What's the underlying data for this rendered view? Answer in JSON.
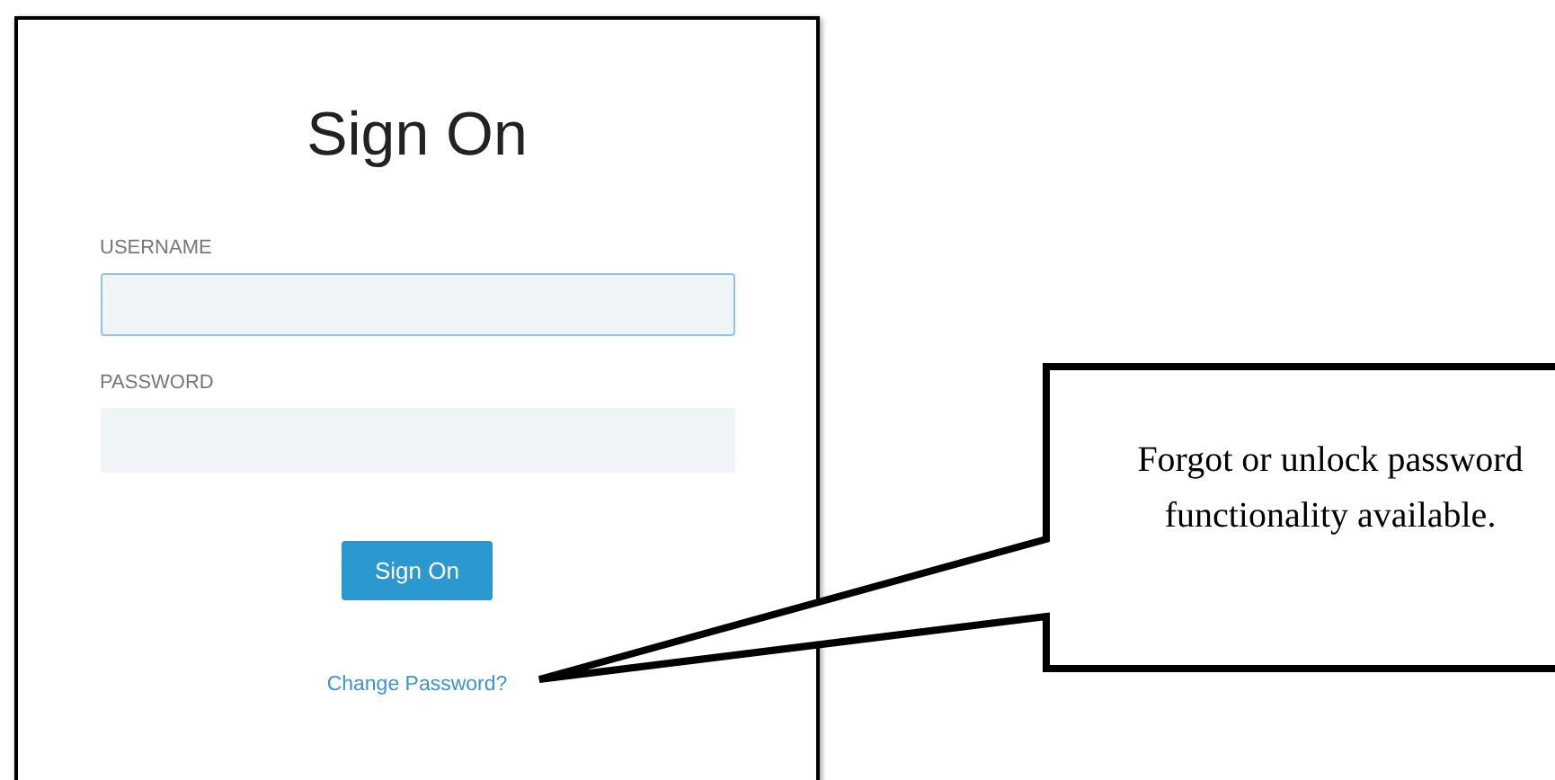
{
  "form": {
    "title": "Sign On",
    "fields": [
      {
        "label": "USERNAME",
        "focused": true
      },
      {
        "label": "PASSWORD",
        "focused": false
      }
    ],
    "button": "Sign On",
    "link": "Change Password?"
  },
  "callout": {
    "text": "Forgot or unlock password functionality available."
  }
}
